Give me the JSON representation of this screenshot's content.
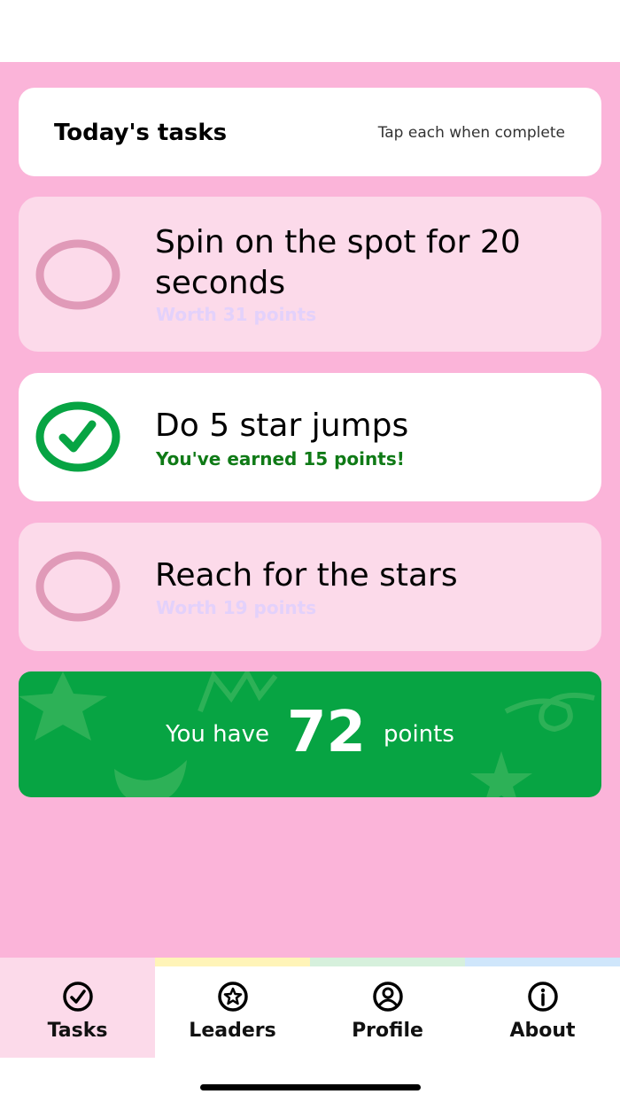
{
  "header": {
    "title": "Today's tasks",
    "hint": "Tap each when complete"
  },
  "tasks": [
    {
      "title": "Spin on the spot for 20 seconds",
      "subtitle": "Worth 31 points",
      "completed": false
    },
    {
      "title": "Do 5 star jumps",
      "subtitle": "You've earned 15 points!",
      "completed": true
    },
    {
      "title": "Reach for the stars",
      "subtitle": "Worth 19 points",
      "completed": false
    }
  ],
  "points": {
    "prefix": "You have",
    "value": "72",
    "suffix": "points"
  },
  "tabs": [
    {
      "label": "Tasks",
      "icon": "check-circle-icon",
      "active": true,
      "accent": "#fcdaea"
    },
    {
      "label": "Leaders",
      "icon": "star-circle-icon",
      "active": false,
      "accent": "#fff4b8"
    },
    {
      "label": "Profile",
      "icon": "user-circle-icon",
      "active": false,
      "accent": "#d6f0dc"
    },
    {
      "label": "About",
      "icon": "info-circle-icon",
      "active": false,
      "accent": "#cfe6fb"
    }
  ],
  "colors": {
    "background": "#fbb4d9",
    "pending_card": "#fcdaea",
    "done_green": "#07a443",
    "pending_ring": "#e09ab8"
  }
}
